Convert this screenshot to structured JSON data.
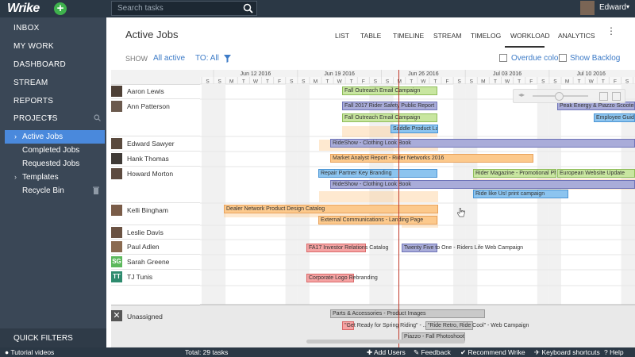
{
  "app": {
    "logo": "Wrike",
    "new_button": "+",
    "search_placeholder": "Search tasks",
    "user_name": "Edward",
    "user_caret": "▾"
  },
  "sidebar": {
    "items": [
      {
        "label": "INBOX"
      },
      {
        "label": "MY WORK"
      },
      {
        "label": "DASHBOARD"
      },
      {
        "label": "STREAM"
      },
      {
        "label": "REPORTS"
      },
      {
        "label": "PROJECTS"
      }
    ],
    "projects_plus": "+",
    "subitems": [
      {
        "label": "Active Jobs",
        "active": true
      },
      {
        "label": "Completed Jobs"
      },
      {
        "label": "Requested Jobs"
      },
      {
        "label": "Templates"
      },
      {
        "label": "Recycle Bin"
      }
    ],
    "quick_filters": "QUICK FILTERS"
  },
  "header": {
    "title": "Active Jobs",
    "tabs": [
      {
        "label": "LIST"
      },
      {
        "label": "TABLE"
      },
      {
        "label": "TIMELINE"
      },
      {
        "label": "STREAM"
      },
      {
        "label": "TIMELOG"
      },
      {
        "label": "WORKLOAD",
        "active": true
      },
      {
        "label": "ANALYTICS"
      }
    ],
    "menu": "⋮"
  },
  "filters": {
    "show_label": "SHOW",
    "show_value": "All active",
    "to_value": "TO: All",
    "overdue_color": "Overdue color",
    "show_backlog": "Show Backlog"
  },
  "timeline": {
    "weeks": [
      "Jun 12 2016",
      "Jun 19 2016",
      "Jun 26 2016",
      "Jul 03 2016",
      "Jul 10 2016"
    ],
    "day_letters": [
      "S",
      "M",
      "T",
      "W",
      "T",
      "F",
      "S"
    ],
    "today_line_color": "#c0392b"
  },
  "people": [
    {
      "name": "Aaron Lewis",
      "avatar": "photo"
    },
    {
      "name": "Ann Patterson",
      "avatar": "photo"
    },
    {
      "name": "Edward Sawyer",
      "avatar": "photo"
    },
    {
      "name": "Hank Thomas",
      "avatar": "photo"
    },
    {
      "name": "Howard Morton",
      "avatar": "photo"
    },
    {
      "name": "Kelli Bingham",
      "avatar": "photo"
    },
    {
      "name": "Leslie Davis",
      "avatar": "photo"
    },
    {
      "name": "Paul Adlen",
      "avatar": "photo"
    },
    {
      "name": "Sarah Greene",
      "avatar": "SG",
      "color": "#5cb85c"
    },
    {
      "name": "TJ Tunis",
      "avatar": "TT",
      "color": "#2e8b6e"
    },
    {
      "name": "Unassigned",
      "avatar": "x-icon"
    }
  ],
  "tasks": [
    {
      "label": "Fall Outreach Email Campaign",
      "color": "green"
    },
    {
      "label": "Fall 2017 Rider Safety Public Report",
      "color": "purple"
    },
    {
      "label": "Peak Energy & Piazzo Scooters",
      "color": "purple"
    },
    {
      "label": "Fall Outreach Email Campaign",
      "color": "green"
    },
    {
      "label": "Employee Guide",
      "color": "blue"
    },
    {
      "label": "Saddle Product Launch",
      "color": "blue"
    },
    {
      "label": "RideShow - Clothing Look Book",
      "color": "purple"
    },
    {
      "label": "Market Analyst Report - Rider Networks 2016",
      "color": "orange"
    },
    {
      "label": "Repair Partner Key Branding",
      "color": "blue"
    },
    {
      "label": "Rider Magazine - Promotional Ph...",
      "color": "green"
    },
    {
      "label": "European Website Update",
      "color": "green"
    },
    {
      "label": "RideShow - Clothing Look Book",
      "color": "purple"
    },
    {
      "label": "Ride like Us! print campaign",
      "color": "blue"
    },
    {
      "label": "Dealer Network Product Design Catalog",
      "color": "orange"
    },
    {
      "label": "External Communications - Landing Page",
      "color": "orange"
    },
    {
      "label": "FA17 Investor Relations Catalog",
      "color": "red"
    },
    {
      "label": "Twenty Five to One - Riders Life Web Campaign",
      "color": "purple"
    },
    {
      "label": "Corporate Logo Rebranding",
      "color": "red"
    },
    {
      "label": "Parts & Accessories - Product Images",
      "color": "gray"
    },
    {
      "label": "\"Get Ready for Spring Riding\" - ...",
      "color": "red"
    },
    {
      "label": "\"Ride Retro, Ride Cool\" - Web Campaign",
      "color": "gray"
    },
    {
      "label": "Piazzo - Fall Photoshoot",
      "color": "gray"
    }
  ],
  "statusbar": {
    "tutorial": "Tutorial videos",
    "total": "Total: 29 tasks",
    "add_users": "Add Users",
    "feedback": "Feedback",
    "recommend": "Recommend Wrike",
    "shortcuts": "Keyboard shortcuts",
    "help": "Help"
  }
}
